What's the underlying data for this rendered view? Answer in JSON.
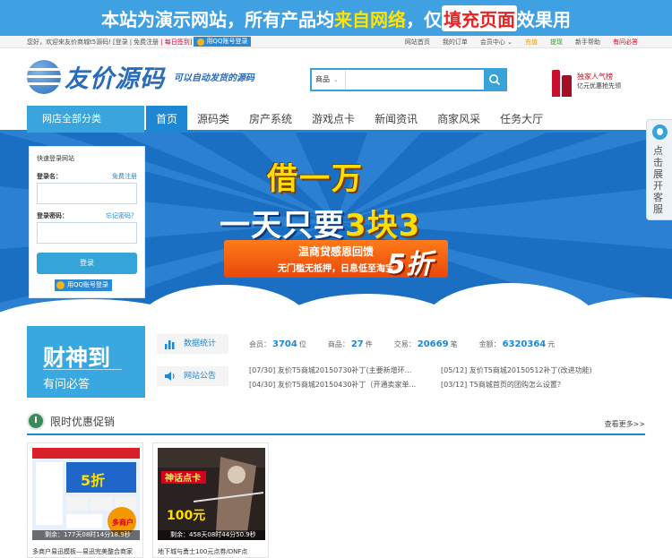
{
  "demo_banner": {
    "part1": "本站为演示网站，所有产品均",
    "highlight1": "来自网络",
    "part2": "，仅",
    "highlight2": "填充页面",
    "part3": "效果用"
  },
  "topbar": {
    "welcome": "您好，欢迎来友价商城t5源码!",
    "login": "[登录",
    "sep": "|",
    "register": "免费注册",
    "signin": "| 每日签到]",
    "qq_login": "用QQ账号登录",
    "links": [
      "网站首页",
      "我的订单",
      "会员中心 ⌄",
      "充值",
      "提现",
      "新手帮助",
      "有问必答"
    ]
  },
  "logo": {
    "name": "友价源码",
    "slogan": "可以自动发货的源码"
  },
  "search": {
    "category": "商品",
    "placeholder": ""
  },
  "promo": {
    "line1": "独家人气榜",
    "line2": "亿元优惠抢先领"
  },
  "nav": {
    "all_categories": "网店全部分类",
    "items": [
      "首页",
      "源码类",
      "房产系统",
      "游戏点卡",
      "新闻资讯",
      "商家风采",
      "任务大厅"
    ]
  },
  "hero": {
    "line1": "借一万",
    "line2_a": "一天只要",
    "line2_b": "3块3",
    "ribbon1": "温商贷感恩回馈",
    "ribbon2": "无门槛无抵押，日息低至淘宝",
    "discount": "5折"
  },
  "login": {
    "title": "快速登录网站",
    "username_label": "登录名：",
    "register_link": "免费注册",
    "password_label": "登录密码：",
    "forgot_link": "忘记密码？",
    "submit": "登录",
    "qq_login": "用QQ账号登录"
  },
  "side_float": {
    "text": "点击展开客服"
  },
  "caishen": {
    "big": "财神到",
    "small": "有问必答"
  },
  "stats": {
    "tab1": "数据统计",
    "tab2": "网站公告",
    "members_label": "会员：",
    "members": "3704",
    "members_unit": "位",
    "goods_label": "商品：",
    "goods": "27",
    "goods_unit": "件",
    "trades_label": "交易：",
    "trades": "20669",
    "trades_unit": "笔",
    "amount_label": "金额：",
    "amount": "6320364",
    "amount_unit": "元"
  },
  "notices": [
    "[07/30] 友价T5商城20150730补丁(主要新增环...",
    "[05/12] 友价T5商城20150512补丁(改进功能)",
    "[04/30] 友价T5商城20150430补丁（开通卖家单...",
    "[03/12] T5商城首页的团购怎么设置？"
  ],
  "section": {
    "title": "限时优惠促销",
    "more": "查看更多>>"
  },
  "cards": [
    {
      "timer": "剩余：177天08时14分18.9秒",
      "caption": "多商户易迅模板—易迅完美整合商家"
    },
    {
      "timer": "剩余：458天08时44分50.9秒",
      "caption": "地下城与勇士100元点券/DNF点"
    }
  ],
  "colors": {
    "brand_blue": "#1e87d4",
    "accent_light_blue": "#3aa4dc",
    "hero_blue": "#1b6fc2"
  }
}
